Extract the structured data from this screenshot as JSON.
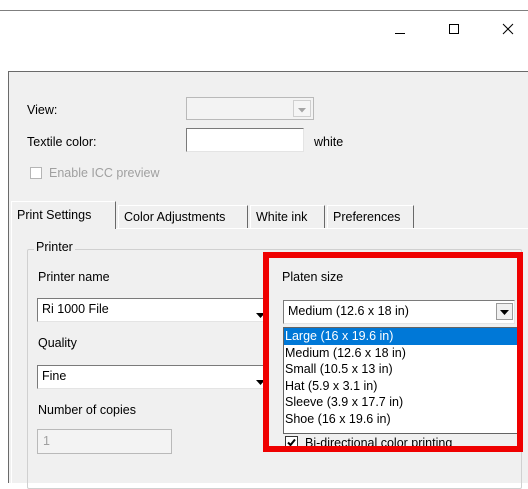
{
  "window": {
    "minimize_icon": "minimize-icon",
    "maximize_icon": "maximize-icon",
    "close_icon": "close-icon"
  },
  "top": {
    "view_label": "View:",
    "view_value": "",
    "textile_label": "Textile color:",
    "textile_value": "white",
    "icc_label": "Enable ICC preview",
    "icc_checked": false
  },
  "tabs": [
    {
      "label": "Print Settings",
      "active": true
    },
    {
      "label": "Color Adjustments",
      "active": false
    },
    {
      "label": "White ink",
      "active": false
    },
    {
      "label": "Preferences",
      "active": false
    }
  ],
  "printer": {
    "group_title": "Printer",
    "printer_name_label": "Printer name",
    "printer_name_value": "Ri 1000 File",
    "quality_label": "Quality",
    "quality_value": "Fine",
    "copies_label": "Number of copies",
    "copies_value": "1"
  },
  "platen": {
    "label": "Platen size",
    "value": "Medium (12.6 x 18 in)",
    "options": [
      "Large (16 x 19.6 in)",
      "Medium (12.6 x 18 in)",
      "Small (10.5 x 13 in)",
      "Hat (5.9 x 3.1 in)",
      "Sleeve (3.9 x 17.7 in)",
      "Shoe (16 x 19.6 in)"
    ],
    "highlighted_index": 0
  },
  "bidirectional": {
    "label": "Bi-directional color printing",
    "checked": true
  },
  "colors": {
    "selection": "#0078d7",
    "annotation": "#ef0000"
  }
}
